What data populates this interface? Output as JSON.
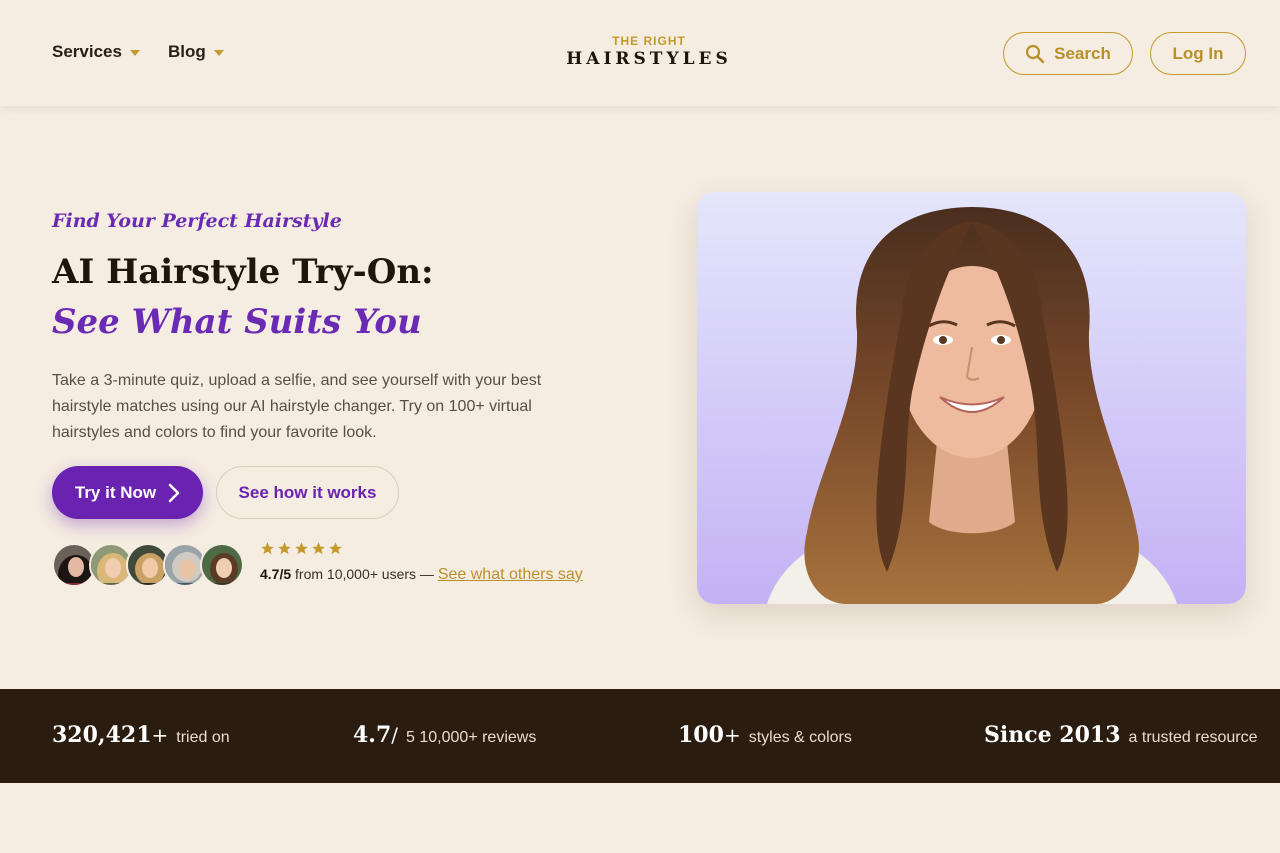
{
  "header": {
    "nav": [
      {
        "label": "Services"
      },
      {
        "label": "Blog"
      }
    ],
    "logo": {
      "top": "THE RIGHT",
      "main": "HAIRSTYLES"
    },
    "search_label": "Search",
    "login_label": "Log In"
  },
  "hero": {
    "eyebrow": "Find Your Perfect Hairstyle",
    "title_line1": "AI Hairstyle Try-On:",
    "title_line2": "See What Suits You",
    "description": "Take a 3-minute quiz, upload a selfie, and see yourself with your best hairstyle matches using our AI hairstyle changer. Try on 100+ virtual hairstyles and colors to find your favorite look.",
    "cta_primary": "Try it Now",
    "cta_secondary": "See how it works",
    "rating": {
      "stars": 5,
      "score": "4.7/5",
      "text": " from 10,000+ users — ",
      "link": "See what others say"
    }
  },
  "stats": [
    {
      "big": "320,421",
      "sup": "+",
      "small": "tried on"
    },
    {
      "big": "4.7",
      "sup": "/",
      "small": "5 10,000+ reviews"
    },
    {
      "big": "100",
      "sup": "+",
      "small": "styles & colors"
    },
    {
      "big": "Since 2013",
      "sup": "",
      "small": "a trusted resource"
    }
  ],
  "colors": {
    "background": "#f5ece2",
    "accent_gold": "#c49a2c",
    "accent_purple": "#6a22b0",
    "stats_bar": "#2a1d10"
  },
  "icons": {
    "search": "search-icon",
    "chevron": "chevron-right-icon",
    "star": "star-icon",
    "caret": "caret-down-icon"
  }
}
